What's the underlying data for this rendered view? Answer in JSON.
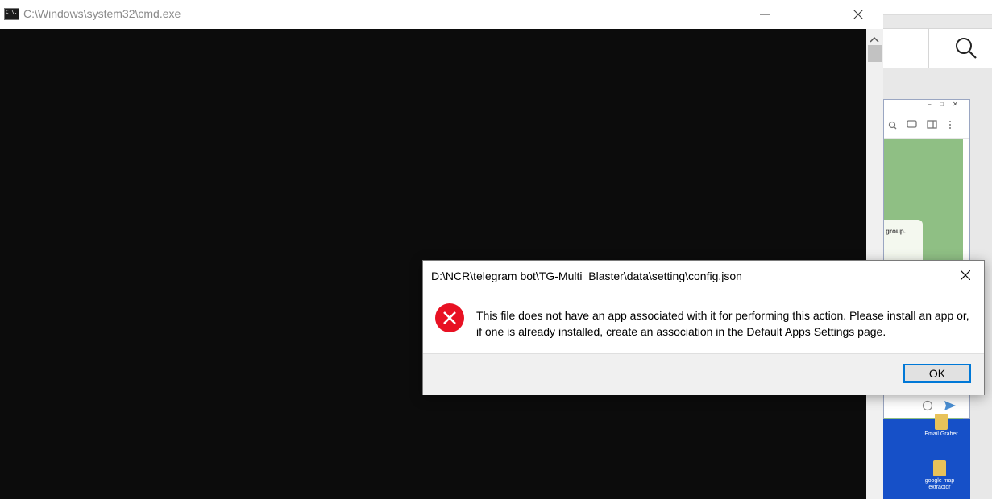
{
  "cmd_window": {
    "icon_label": "C:\\.",
    "title": "C:\\Windows\\system32\\cmd.exe"
  },
  "dialog": {
    "title": "D:\\NCR\\telegram bot\\TG-Multi_Blaster\\data\\setting\\config.json",
    "message": "This file does not have an app associated with it for performing this action. Please install an app or, if one is already installed, create an association in the Default Apps Settings page.",
    "ok_label": "OK",
    "error_color": "#e81123"
  },
  "background": {
    "chat_preview_text": "group.",
    "desktop_icons": [
      "Email Graber",
      "google map extractor"
    ]
  }
}
